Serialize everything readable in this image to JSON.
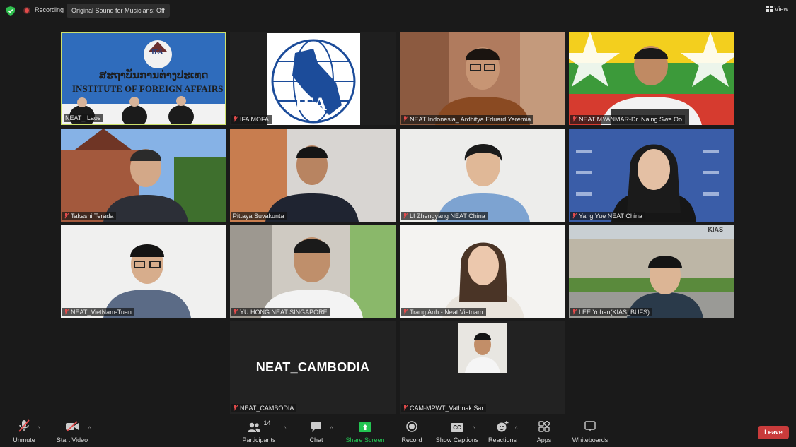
{
  "topbar": {
    "recording_label": "Recording",
    "original_sound_label": "Original Sound for Musicians: Off",
    "view_label": "View"
  },
  "tiles": [
    {
      "name": "NEAT_ Laos",
      "sign_text": "ສະຖາບັນການຕ່າງປະເທດ",
      "sign_text_en": "INSTITUTE OF FOREIGN AFFAIRS",
      "logo_text": "IFA",
      "muted": false,
      "active": true
    },
    {
      "name": "IFA MOFA",
      "logo_text": "IFA",
      "muted": true
    },
    {
      "name": "NEAT Indonesia_ Ardhitya Eduard Yeremia",
      "muted": true
    },
    {
      "name": "NEAT MYANMAR-Dr. Naing Swe Oo",
      "muted": true
    },
    {
      "name": "Takashi Terada",
      "muted": true
    },
    {
      "name": "Pittaya Suvakunta",
      "muted": false
    },
    {
      "name": "LI Zhengyang NEAT China",
      "muted": true
    },
    {
      "name": "Yang Yue NEAT China",
      "muted": true
    },
    {
      "name": "NEAT_VietNam-Tuan",
      "muted": true
    },
    {
      "name": "YU HONG NEAT SINGAPORE",
      "muted": true
    },
    {
      "name": "Trang Anh - Neat Vietnam",
      "muted": true
    },
    {
      "name": "LEE Yohan(KIAS_BUFS)",
      "logo_text": "KIAS",
      "muted": true
    },
    {
      "name": "NEAT_CAMBODIA",
      "display_text": "NEAT_CAMBODIA",
      "muted": true
    },
    {
      "name": "CAM-MPWT_Vathnak Sar",
      "muted": true
    }
  ],
  "toolbar": {
    "unmute_label": "Unmute",
    "start_video_label": "Start Video",
    "participants_label": "Participants",
    "participants_count": "14",
    "chat_label": "Chat",
    "share_screen_label": "Share Screen",
    "record_label": "Record",
    "captions_label": "Show Captions",
    "captions_icon_text": "CC",
    "reactions_label": "Reactions",
    "apps_label": "Apps",
    "whiteboards_label": "Whiteboards",
    "leave_label": "Leave"
  },
  "colors": {
    "background": "#1a1a1a",
    "active_speaker_border": "#cde06b",
    "share_screen_green": "#23c552",
    "leave_red": "#c93b3b",
    "muted_red": "#e34b4b"
  }
}
